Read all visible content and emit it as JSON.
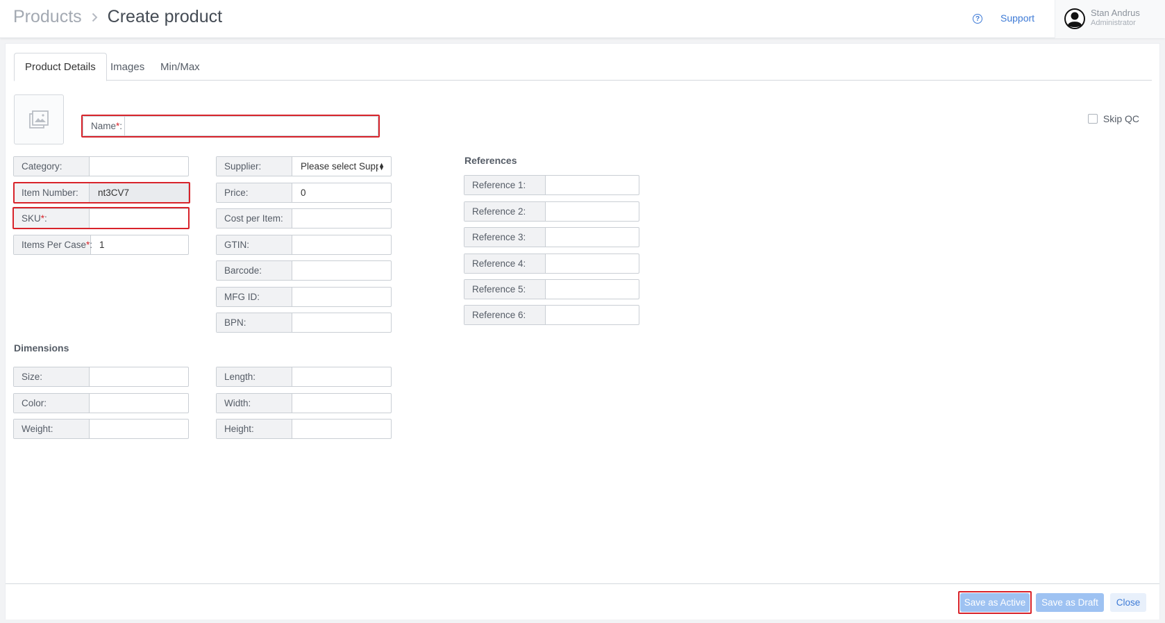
{
  "header": {
    "breadcrumb_root": "Products",
    "breadcrumb_current": "Create product",
    "support_label": "Support",
    "user_name": "Stan Andrus",
    "user_role": "Administrator"
  },
  "tabs": [
    "Product Details",
    "Images",
    "Min/Max"
  ],
  "skip_qc_label": "Skip QC",
  "name_field": {
    "label": "Name",
    "value": ""
  },
  "left_fields": {
    "category": {
      "label": "Category:",
      "value": ""
    },
    "item_number": {
      "label": "Item Number:",
      "value": "nt3CV7"
    },
    "sku": {
      "label": "SKU",
      "value": ""
    },
    "items_per_case": {
      "label": "Items Per Case",
      "value": "1"
    }
  },
  "mid_fields": {
    "supplier": {
      "label": "Supplier:",
      "value": "Please select Supplier"
    },
    "price": {
      "label": "Price:",
      "value": "0"
    },
    "cost_per_item": {
      "label": "Cost per Item:",
      "value": ""
    },
    "gtin": {
      "label": "GTIN:",
      "value": ""
    },
    "barcode": {
      "label": "Barcode:",
      "value": ""
    },
    "mfg_id": {
      "label": "MFG ID:",
      "value": ""
    },
    "bpn": {
      "label": "BPN:",
      "value": ""
    }
  },
  "references": {
    "title": "References",
    "items": [
      {
        "label": "Reference 1:",
        "value": ""
      },
      {
        "label": "Reference 2:",
        "value": ""
      },
      {
        "label": "Reference 3:",
        "value": ""
      },
      {
        "label": "Reference 4:",
        "value": ""
      },
      {
        "label": "Reference 5:",
        "value": ""
      },
      {
        "label": "Reference 6:",
        "value": ""
      }
    ]
  },
  "dimensions": {
    "title": "Dimensions",
    "size": {
      "label": "Size:",
      "value": ""
    },
    "color": {
      "label": "Color:",
      "value": ""
    },
    "weight": {
      "label": "Weight:",
      "value": ""
    },
    "length": {
      "label": "Length:",
      "value": ""
    },
    "width": {
      "label": "Width:",
      "value": ""
    },
    "height": {
      "label": "Height:",
      "value": ""
    }
  },
  "footer": {
    "save_active": "Save as Active",
    "save_draft": "Save as Draft",
    "close": "Close"
  },
  "colors": {
    "accent": "#3d7ad6",
    "required": "#d8232a",
    "primary_disabled": "#9ec2f2"
  }
}
